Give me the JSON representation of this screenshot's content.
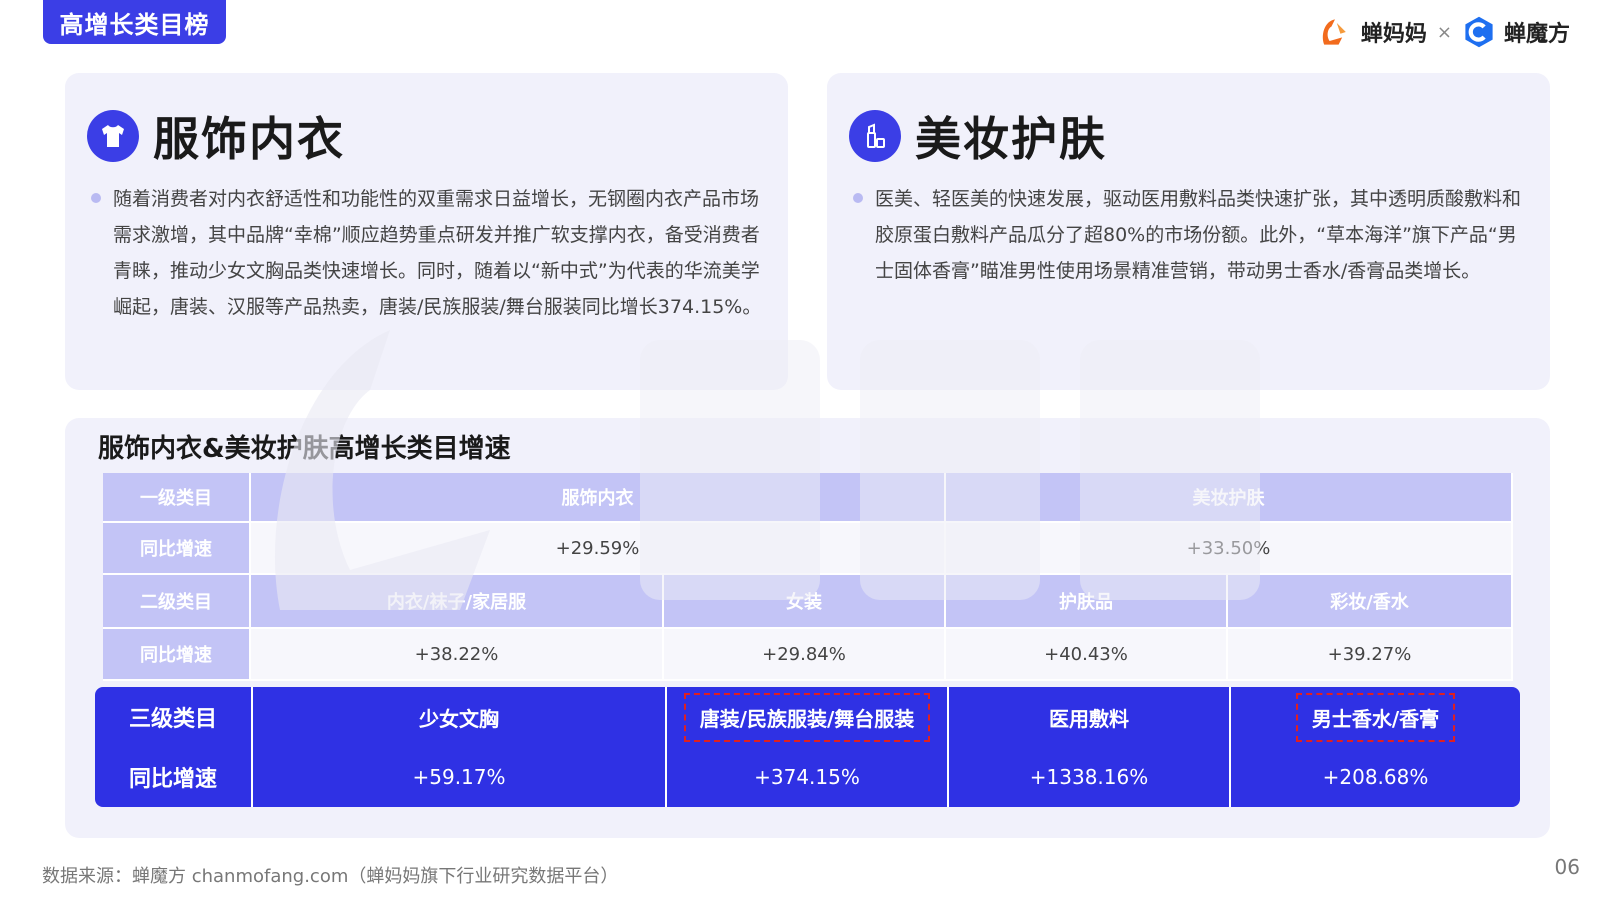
{
  "header": {
    "tag": "高增长类目榜",
    "brand_a": "蝉妈妈",
    "brand_sep": "×",
    "brand_b": "蝉魔方"
  },
  "cards": {
    "left": {
      "title": "服饰内衣",
      "icon": "tshirt-icon",
      "text": "随着消费者对内衣舒适性和功能性的双重需求日益增长，无钢圈内衣产品市场需求激增，其中品牌“幸棉”顺应趋势重点研发并推广软支撑内衣，备受消费者青睐，推动少女文胸品类快速增长。同时，随着以“新中式”为代表的华流美学崛起，唐装、汉服等产品热卖，唐装/民族服装/舞台服装同比增长374.15%。"
    },
    "right": {
      "title": "美妆护肤",
      "icon": "lipstick-icon",
      "text": "医美、轻医美的快速发展，驱动医用敷料品类快速扩张，其中透明质酸敷料和胶原蛋白敷料产品瓜分了超80%的市场份额。此外，“草本海洋”旗下产品“男士固体香膏”瞄准男性使用场景精准营销，带动男士香水/香膏品类增长。"
    }
  },
  "table": {
    "title": "服饰内衣&美妆护肤高增长类目增速",
    "level1_label": "一级类目",
    "level1": [
      "服饰内衣",
      "美妆护肤"
    ],
    "yoy_label": "同比增速",
    "level1_yoy": [
      "+29.59%",
      "+33.50%"
    ],
    "level2_label": "二级类目",
    "level2": [
      "内衣/袜子/家居服",
      "女装",
      "护肤品",
      "彩妆/香水"
    ],
    "level2_yoy": [
      "+38.22%",
      "+29.84%",
      "+40.43%",
      "+39.27%"
    ],
    "level3_label": "三级类目",
    "level3": [
      "少女文胸",
      "唐装/民族服装/舞台服装",
      "医用敷料",
      "男士香水/香膏"
    ],
    "level3_yoy": [
      "+59.17%",
      "+374.15%",
      "+1338.16%",
      "+208.68%"
    ]
  },
  "colors": {
    "accent": "#3b3ee6",
    "band": "#2f31e4",
    "header_cell": "#c3c4f6",
    "card_bg": "#f1f1fb",
    "highlight": "#e02020"
  },
  "footer": {
    "source": "数据来源：蝉魔方 chanmofang.com（蝉妈妈旗下行业研究数据平台）",
    "page": "06"
  }
}
